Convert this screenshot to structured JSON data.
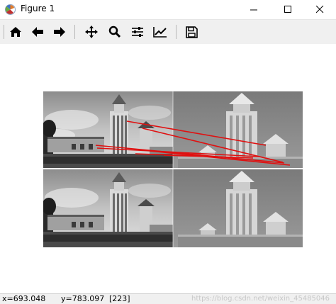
{
  "window": {
    "title": "Figure 1",
    "buttons": {
      "minimize": "minimize-icon",
      "maximize": "maximize-icon",
      "close": "close-icon"
    }
  },
  "toolbar": {
    "items": [
      {
        "name": "home-icon"
      },
      {
        "name": "back-arrow-icon"
      },
      {
        "name": "forward-arrow-icon"
      },
      {
        "name": "pan-icon"
      },
      {
        "name": "zoom-icon"
      },
      {
        "name": "subplots-config-icon"
      },
      {
        "name": "edit-axis-icon"
      },
      {
        "name": "save-icon"
      }
    ]
  },
  "figure": {
    "description": "grayscale building photo pairs with red matching lines",
    "colors": {
      "match_line": "#e01010"
    }
  },
  "status": {
    "x": "x=693.048",
    "y": "y=783.097",
    "value": "[223]",
    "watermark": "https://blog.csdn.net/weixin_45485046"
  }
}
